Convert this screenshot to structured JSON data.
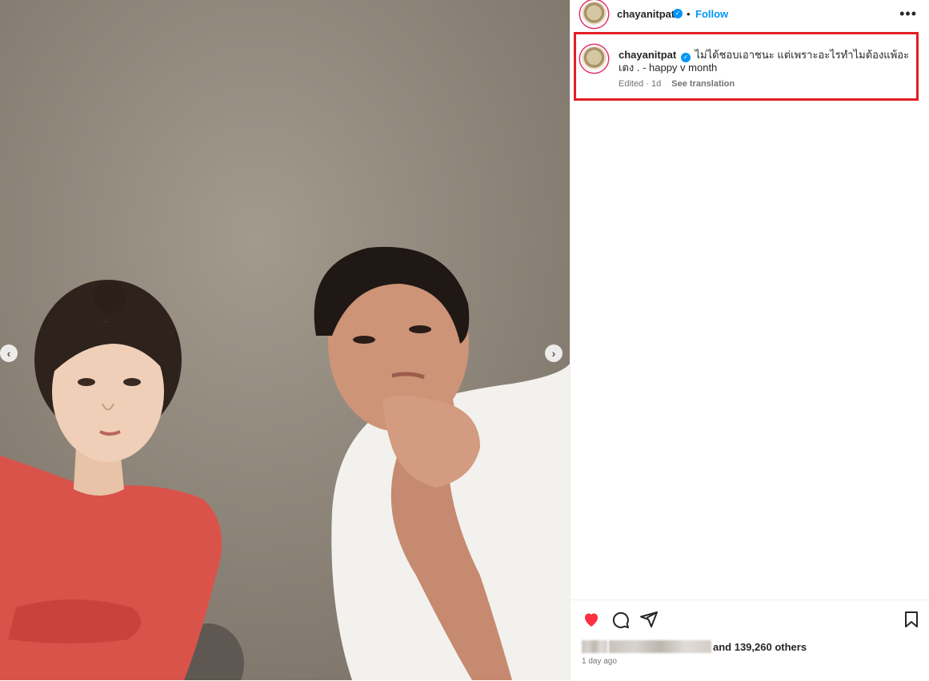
{
  "post": {
    "username": "chayanitpat",
    "follow_label": "Follow",
    "separator": "•",
    "more_label": "•••",
    "caption_text": "ไม่ได้ชอบเอาชนะ แต่เพราะอะไรทำไมต้องแพ้อะเตง . - happy v month",
    "edited_label": "Edited · 1d",
    "see_translation": "See translation",
    "likes_suffix": "and 139,260 others",
    "date_label": "1 day ago"
  },
  "media": {
    "prev_label": "‹",
    "next_label": "›"
  },
  "icons": [
    "heart-icon",
    "comment-icon",
    "share-icon",
    "bookmark-icon",
    "verified-icon",
    "more-icon"
  ],
  "colors": {
    "like_red": "#ff3040",
    "link_blue": "#0095f6",
    "highlight_red": "#e31e24"
  }
}
